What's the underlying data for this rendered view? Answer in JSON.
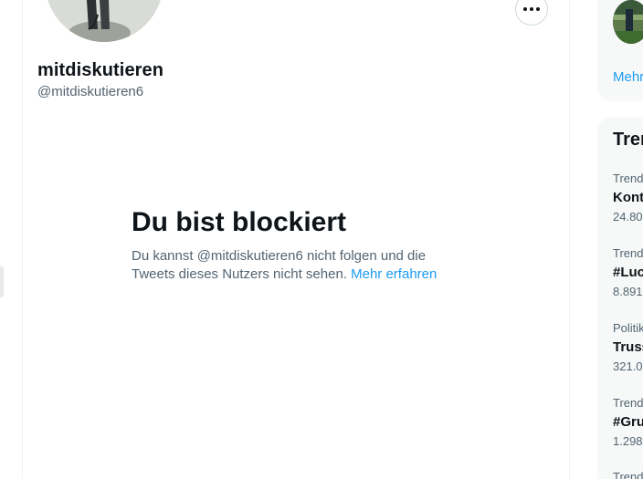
{
  "profile": {
    "name": "mitdiskutieren",
    "handle": "@mitdiskutieren6"
  },
  "blocked": {
    "title": "Du bist blockiert",
    "text": "Du kannst @mitdiskutieren6 nicht folgen und die Tweets dieses Nutzers nicht sehen.",
    "link": "Mehr erfahren"
  },
  "sidebar": {
    "show_more": "Mehr",
    "trends_title": "Tren",
    "trends": [
      {
        "category": "Trend",
        "name": "Kont",
        "count": "24.80"
      },
      {
        "category": "Trend",
        "name": "#Luc",
        "count": "8.891"
      },
      {
        "category": "Politik",
        "name": "Truss",
        "count": "321.0"
      },
      {
        "category": "Trend",
        "name": "#Gru",
        "count": "1.298"
      },
      {
        "category": "Trend",
        "name": "",
        "count": ""
      }
    ]
  },
  "icons": {
    "more": "more-horizontal-icon"
  },
  "colors": {
    "accent": "#1d9bf0",
    "text": "#0f1419",
    "secondary_text": "#536471",
    "card_bg": "#f7f9f9"
  }
}
